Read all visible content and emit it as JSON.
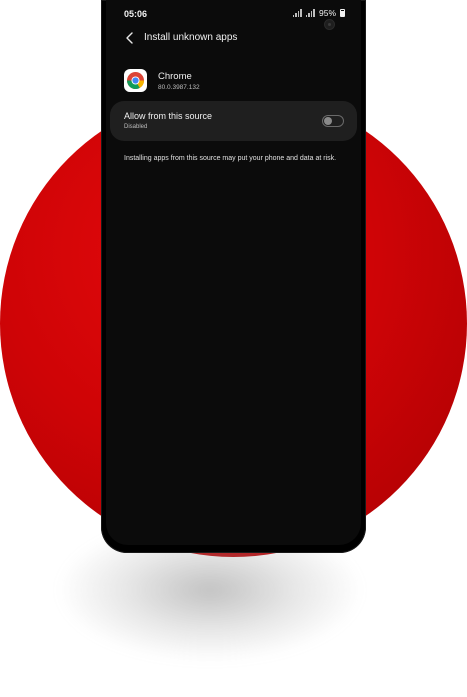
{
  "status_bar": {
    "time": "05:06",
    "battery_percent": "95%",
    "icons": [
      "signal-icon",
      "signal-icon",
      "battery-icon"
    ]
  },
  "header": {
    "back_icon": "back-arrow-icon",
    "title": "Install unknown apps"
  },
  "app": {
    "icon": "chrome-icon",
    "name": "Chrome",
    "version": "80.0.3987.132"
  },
  "allow_setting": {
    "label": "Allow from this source",
    "status": "Disabled",
    "enabled": false
  },
  "warning_text": "Installing apps from this source may put your phone and data at risk.",
  "colors": {
    "background_circle": "#cf0406",
    "screen_bg": "#0b0b0b",
    "card_bg": "#1f1f1f"
  }
}
